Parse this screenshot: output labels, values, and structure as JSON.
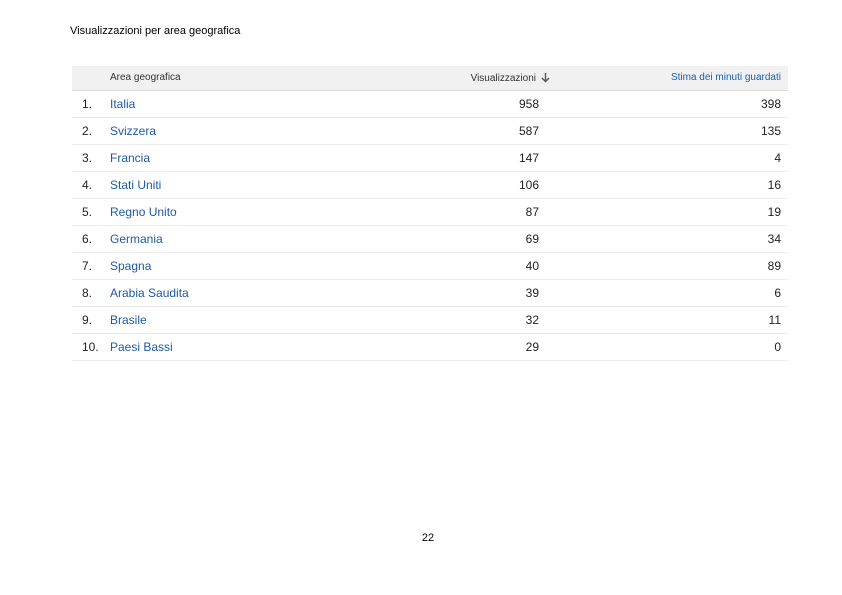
{
  "report": {
    "title": "Visualizzazioni per area geografica"
  },
  "table": {
    "headers": {
      "area": "Area geografica",
      "views": "Visualizzazioni",
      "minutes": "Stima dei minuti guardati"
    },
    "sort_icon": "arrow-down-icon",
    "rows": [
      {
        "rank": "1.",
        "area": "Italia",
        "views": "958",
        "minutes": "398"
      },
      {
        "rank": "2.",
        "area": "Svizzera",
        "views": "587",
        "minutes": "135"
      },
      {
        "rank": "3.",
        "area": "Francia",
        "views": "147",
        "minutes": "4"
      },
      {
        "rank": "4.",
        "area": "Stati Uniti",
        "views": "106",
        "minutes": "16"
      },
      {
        "rank": "5.",
        "area": "Regno Unito",
        "views": "87",
        "minutes": "19"
      },
      {
        "rank": "6.",
        "area": "Germania",
        "views": "69",
        "minutes": "34"
      },
      {
        "rank": "7.",
        "area": "Spagna",
        "views": "40",
        "minutes": "89"
      },
      {
        "rank": "8.",
        "area": "Arabia Saudita",
        "views": "39",
        "minutes": "6"
      },
      {
        "rank": "9.",
        "area": "Brasile",
        "views": "32",
        "minutes": "11"
      },
      {
        "rank": "10.",
        "area": "Paesi Bassi",
        "views": "29",
        "minutes": "0"
      }
    ]
  },
  "page": {
    "number": "22"
  },
  "colors": {
    "link": "#1f5aa6",
    "header_bg": "#f1f1f1"
  }
}
